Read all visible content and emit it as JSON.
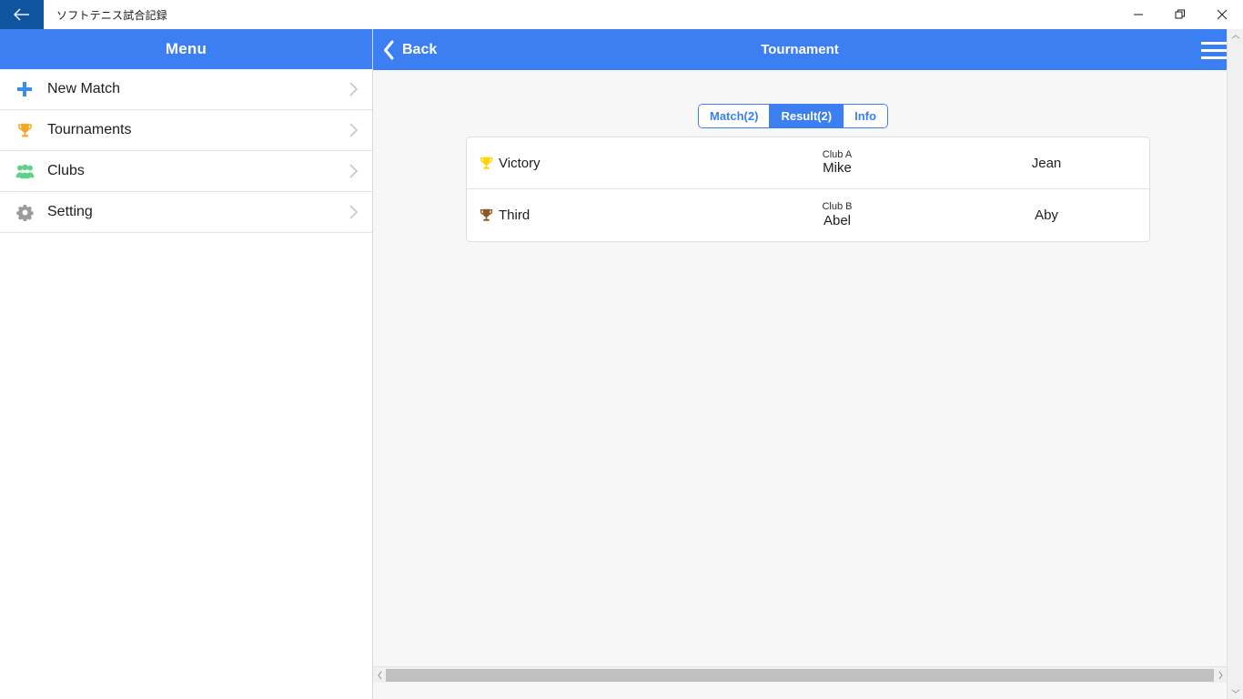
{
  "window": {
    "title": "ソフトテニス試合記録",
    "back_icon": "arrow-left-icon",
    "minimize_label": "Minimize",
    "maximize_label": "Restore",
    "close_label": "Close"
  },
  "sidebar": {
    "header_title": "Menu",
    "items": [
      {
        "label": "New Match",
        "icon": "plus-icon",
        "icon_color": "#3b8ef0"
      },
      {
        "label": "Tournaments",
        "icon": "trophy-icon",
        "icon_color": "#f5a623"
      },
      {
        "label": "Clubs",
        "icon": "people-icon",
        "icon_color": "#5fd28a"
      },
      {
        "label": "Setting",
        "icon": "gear-icon",
        "icon_color": "#9b9b9b"
      }
    ]
  },
  "app_header": {
    "back_label": "Back",
    "back_icon": "chevron-left-icon",
    "title": "Tournament",
    "menu_icon": "hamburger-icon"
  },
  "tabs": [
    {
      "label": "Match(2)",
      "selected": false
    },
    {
      "label": "Result(2)",
      "selected": true
    },
    {
      "label": "Info",
      "selected": false
    }
  ],
  "results": {
    "rows": [
      {
        "rank": "Victory",
        "rank_icon": "trophy-icon",
        "rank_icon_color": "#ffd400",
        "club": "Club A",
        "player": "Mike",
        "partner": "Jean"
      },
      {
        "rank": "Third",
        "rank_icon": "trophy-icon",
        "rank_icon_color": "#8a5a24",
        "club": "Club B",
        "player": "Abel",
        "partner": "Aby"
      }
    ]
  },
  "colors": {
    "accent_blue": "#3b7ff2",
    "titlebar_blue": "#10539E",
    "content_bg": "#f7f7f7"
  }
}
